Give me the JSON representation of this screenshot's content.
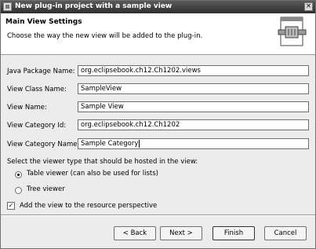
{
  "window": {
    "title": "New plug-in project with a sample view",
    "close_glyph": "×"
  },
  "header": {
    "title": "Main View Settings",
    "subtitle": "Choose the way the new view will be added to the plug-in."
  },
  "fields": [
    {
      "label": "Java Package Name:",
      "value": "org.eclipsebook.ch12.Ch1202.views"
    },
    {
      "label": "View Class Name:",
      "value": "SampleView"
    },
    {
      "label": "View Name:",
      "value": "Sample View"
    },
    {
      "label": "View Category Id:",
      "value": "org.eclipsebook.ch12.Ch1202"
    },
    {
      "label": "View Category Name:",
      "value": "Sample Category"
    }
  ],
  "viewer": {
    "prompt": "Select the viewer type that should be hosted in the view:",
    "options": [
      {
        "label": "Table viewer (can also be used for lists)",
        "selected": true
      },
      {
        "label": "Tree viewer",
        "selected": false
      }
    ]
  },
  "perspective": {
    "label": "Add the view to the resource perspective",
    "checked": true,
    "check_glyph": "✓"
  },
  "buttons": {
    "back": "< Back",
    "next": "Next >",
    "finish": "Finish",
    "cancel": "Cancel"
  },
  "icons": {
    "window": "plugin-window-icon",
    "banner": "wizard-plugin-icon"
  }
}
